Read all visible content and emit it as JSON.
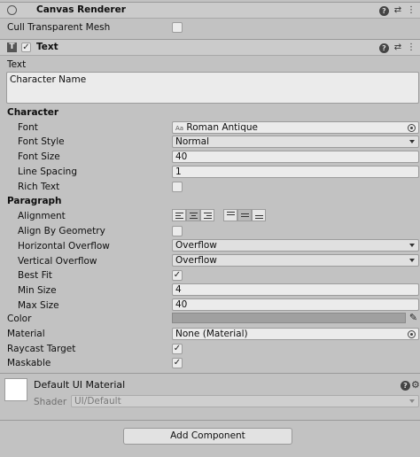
{
  "canvas_renderer": {
    "title": "Canvas Renderer",
    "cull_label": "Cull Transparent Mesh",
    "cull_checked": false
  },
  "text_component": {
    "title": "Text",
    "enabled": true,
    "text_label": "Text",
    "text_value": "Character Name",
    "character_header": "Character",
    "font_label": "Font",
    "font_value": "Roman Antique",
    "font_icon_text": "Aa",
    "font_style_label": "Font Style",
    "font_style_value": "Normal",
    "font_size_label": "Font Size",
    "font_size_value": "40",
    "line_spacing_label": "Line Spacing",
    "line_spacing_value": "1",
    "rich_text_label": "Rich Text",
    "rich_text_checked": false,
    "paragraph_header": "Paragraph",
    "alignment_label": "Alignment",
    "align_by_geometry_label": "Align By Geometry",
    "align_by_geometry_checked": false,
    "horizontal_overflow_label": "Horizontal Overflow",
    "horizontal_overflow_value": "Overflow",
    "vertical_overflow_label": "Vertical Overflow",
    "vertical_overflow_value": "Overflow",
    "best_fit_label": "Best Fit",
    "best_fit_checked": true,
    "min_size_label": "Min Size",
    "min_size_value": "4",
    "max_size_label": "Max Size",
    "max_size_value": "40",
    "color_label": "Color",
    "color_value": "#a0a0a0",
    "material_label": "Material",
    "material_value": "None (Material)",
    "raycast_label": "Raycast Target",
    "raycast_checked": true,
    "maskable_label": "Maskable",
    "maskable_checked": true
  },
  "material": {
    "title": "Default UI Material",
    "shader_label": "Shader",
    "shader_value": "UI/Default"
  },
  "add_component_label": "Add Component",
  "check_glyph": "✓"
}
